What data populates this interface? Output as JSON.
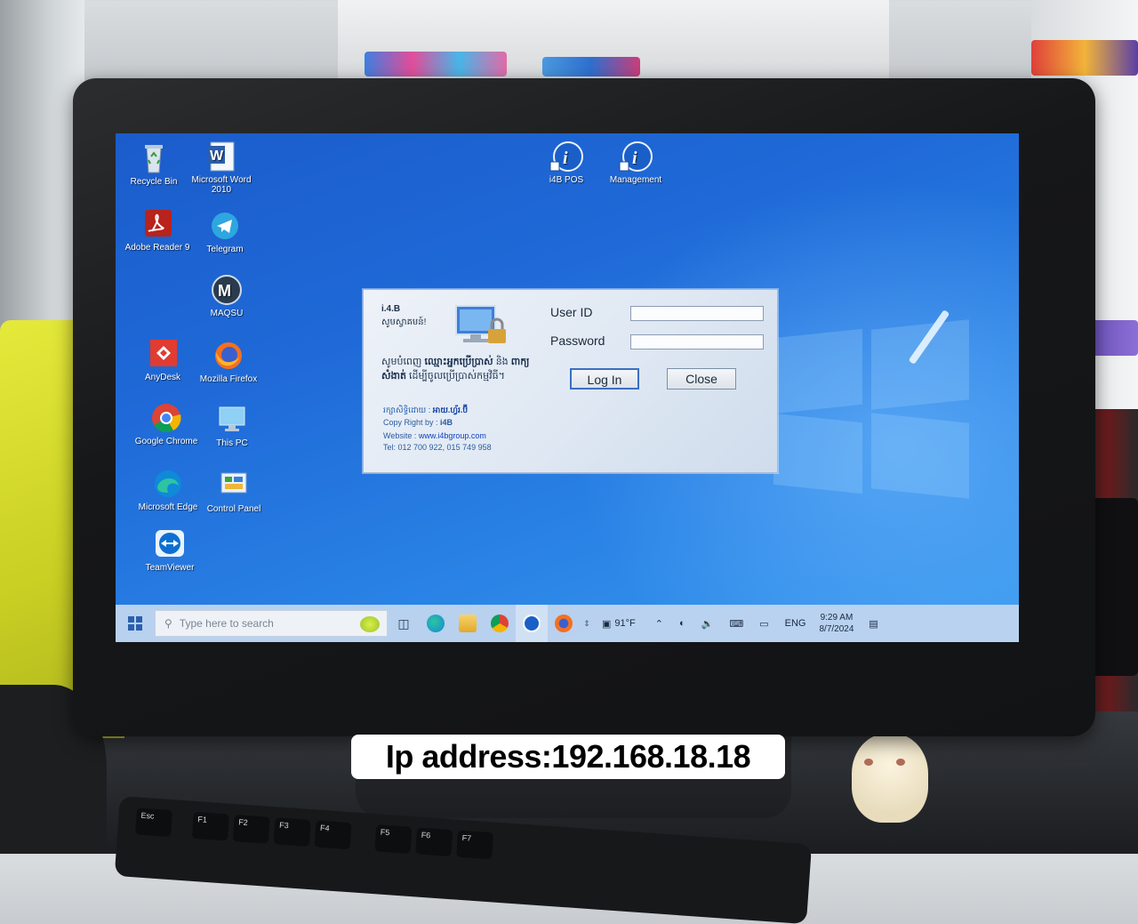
{
  "caption": "Ip address:192.168.18.18",
  "desktop_icons": [
    {
      "label": "Recycle Bin",
      "icon": "recycle-bin-icon"
    },
    {
      "label": "Microsoft Word 2010",
      "icon": "word-icon"
    },
    {
      "label": "i4B POS",
      "icon": "i4b-pos-icon"
    },
    {
      "label": "Management",
      "icon": "i4b-management-icon"
    },
    {
      "label": "Adobe Reader 9",
      "icon": "adobe-reader-icon"
    },
    {
      "label": "Telegram",
      "icon": "telegram-icon"
    },
    {
      "label": "MAQSU",
      "icon": "maqsu-icon"
    },
    {
      "label": "AnyDesk",
      "icon": "anydesk-icon"
    },
    {
      "label": "Mozilla Firefox",
      "icon": "firefox-icon"
    },
    {
      "label": "Google Chrome",
      "icon": "chrome-icon"
    },
    {
      "label": "This PC",
      "icon": "this-pc-icon"
    },
    {
      "label": "Microsoft Edge",
      "icon": "edge-icon"
    },
    {
      "label": "Control Panel",
      "icon": "control-panel-icon"
    },
    {
      "label": "TeamViewer",
      "icon": "teamviewer-icon"
    }
  ],
  "login": {
    "brand": "i.4.B",
    "welcome": "សូមស្វាគមន៍!",
    "instruction_pre": "សូមបំពេញ ",
    "instruction_bold1": "ឈ្មោះអ្នកប្រើប្រាស់",
    "instruction_mid": " និង ",
    "instruction_bold2": "ពាក្យសំងាត់",
    "instruction_post": " ដើម្បីចូលប្រើប្រាស់កម្មវិធី។",
    "copyright_khmer_label": "រក្សាសិទ្ធិដោយ : ",
    "copyright_khmer_name": "អាយ.ហ្វ័រ.ប៊ី",
    "copyright_en_label": "Copy Right by : ",
    "copyright_en_name": "i4B",
    "website_label": "Website : ",
    "website": "www.i4bgroup.com",
    "tel": "Tel: 012 700 922, 015 749 958",
    "userid_label": "User ID",
    "userid_value": "",
    "password_label": "Password",
    "password_value": "",
    "login_button": "Log In",
    "close_button": "Close"
  },
  "taskbar": {
    "search_placeholder": "Type here to search",
    "weather": "91°F",
    "language": "ENG",
    "time": "9:29 AM",
    "date": "8/7/2024",
    "pinned": [
      "task-view-icon",
      "edge-icon",
      "file-explorer-icon",
      "chrome-icon",
      "i4b-pos-icon",
      "firefox-icon"
    ]
  },
  "keyboard_keys": [
    "Esc",
    "F1",
    "F2",
    "F3",
    "F4",
    "F5",
    "F6",
    "F7"
  ]
}
